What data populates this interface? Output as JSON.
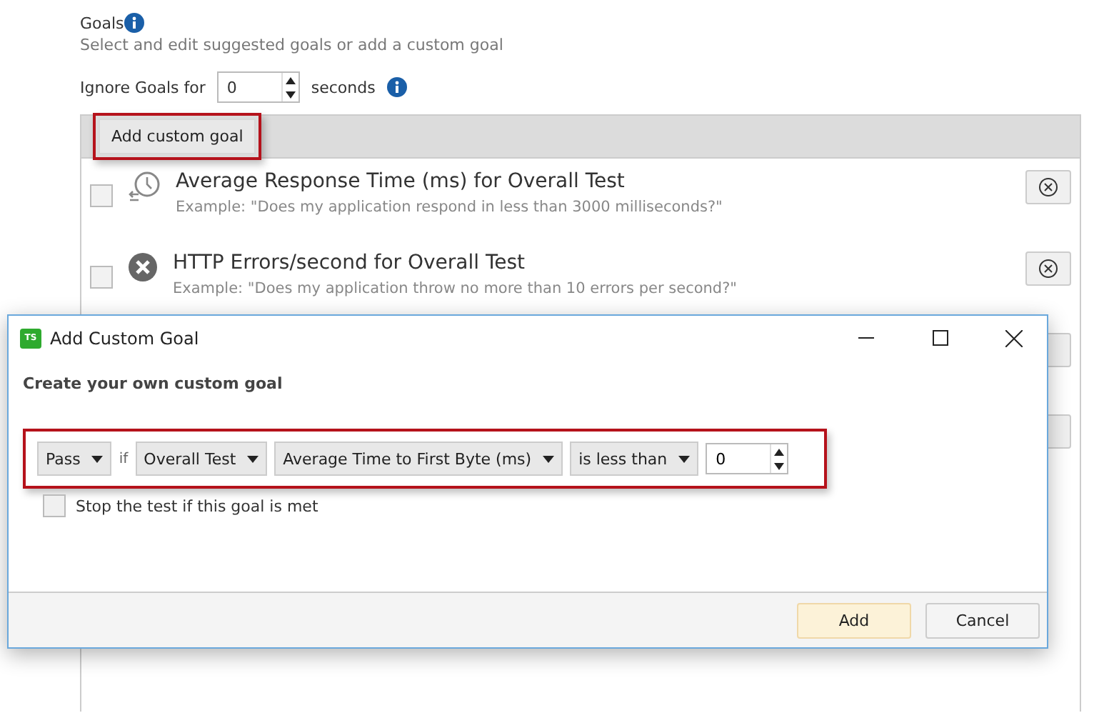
{
  "header": {
    "title": "Goals",
    "subtitle": "Select and edit suggested goals or add a custom goal"
  },
  "ignore": {
    "label": "Ignore Goals for",
    "value": "0",
    "unit": "seconds"
  },
  "toolbar": {
    "button": "Add custom goal",
    "highlighted": true
  },
  "goals": [
    {
      "kind": "clock",
      "title": "Average Response Time (ms) for Overall Test",
      "example": "Example: \"Does my application respond in less than 3000 milliseconds?\"",
      "checked": false
    },
    {
      "kind": "error",
      "title": "HTTP Errors/second for Overall Test",
      "example": "Example: \"Does my application throw no more than 10 errors per second?\"",
      "checked": false
    },
    {
      "kind": "covered"
    },
    {
      "kind": "covered"
    }
  ],
  "dialog": {
    "logo": "TS",
    "title": "Add Custom Goal",
    "heading": "Create your own custom goal",
    "condition": {
      "highlighted": true,
      "result": "Pass",
      "connector": "if",
      "scope": "Overall Test",
      "metric": "Average Time to First Byte (ms)",
      "operator": "is less than",
      "value": "0"
    },
    "stop": {
      "label": "Stop the test if this goal is met",
      "checked": false
    },
    "buttons": [
      {
        "label": "Add",
        "default": true
      },
      {
        "label": "Cancel",
        "default": false
      }
    ]
  }
}
